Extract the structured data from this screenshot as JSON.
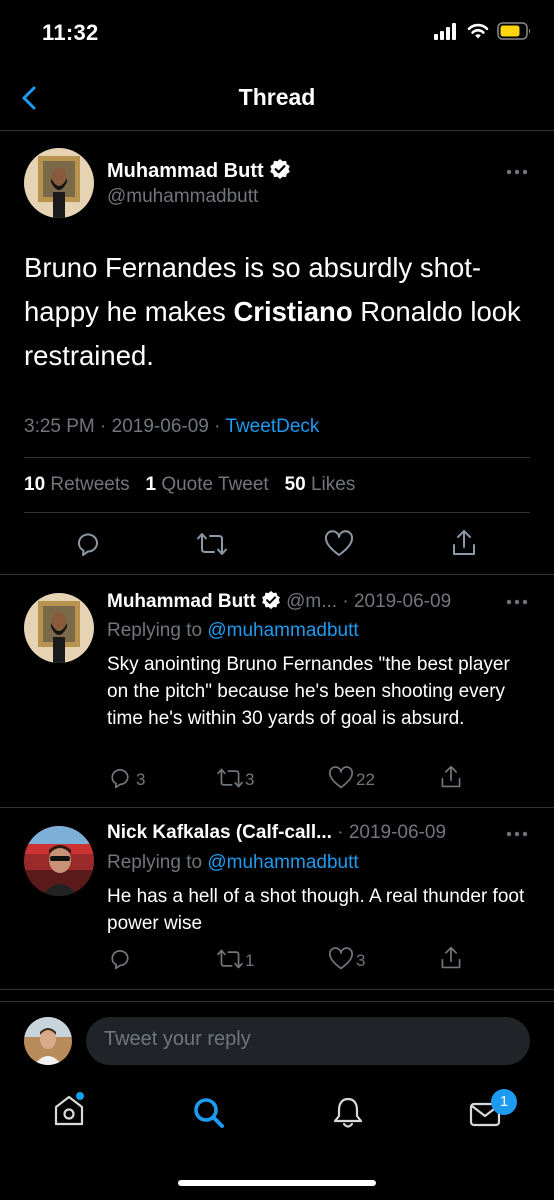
{
  "status_bar": {
    "time": "11:32"
  },
  "nav": {
    "title": "Thread"
  },
  "main_tweet": {
    "author_name": "Muhammad Butt",
    "author_handle": "@muhammadbutt",
    "text_before": "Bruno Fernandes is so absurdly shot-happy he makes ",
    "text_bold": "Cristiano",
    "text_after": " Ronaldo look restrained.",
    "time": "3:25 PM",
    "sep1": "·",
    "date": "2019-06-09",
    "sep2": "·",
    "source": "TweetDeck",
    "stats": {
      "retweets_count": "10",
      "retweets_label": "Retweets",
      "quotes_count": "1",
      "quotes_label": "Quote Tweet",
      "likes_count": "50",
      "likes_label": "Likes"
    }
  },
  "replies": [
    {
      "author_name": "Muhammad Butt",
      "author_handle": "@m...",
      "date": "· 2019-06-09",
      "replying_prefix": "Replying to",
      "replying_handle": "@muhammadbutt",
      "text": "Sky anointing Bruno Fernandes \"the best player on the pitch\" because he's been shooting every time he's within 30 yards of goal is absurd.",
      "replies": "3",
      "retweets": "3",
      "likes": "22"
    },
    {
      "author_name": "Nick Kafkalas (Calf-call...",
      "date": "· 2019-06-09",
      "replying_prefix": "Replying to",
      "replying_handle": "@muhammadbutt",
      "text": "He has a hell of a shot though.  A real thunder foot power wise",
      "replies": "",
      "retweets": "1",
      "likes": "3"
    }
  ],
  "reply_bar": {
    "placeholder": "Tweet your reply"
  },
  "tab_bar": {
    "notification_badge": "1"
  },
  "colors": {
    "accent": "#1d9bf0",
    "background": "#000000",
    "secondary_text": "#71767b"
  }
}
